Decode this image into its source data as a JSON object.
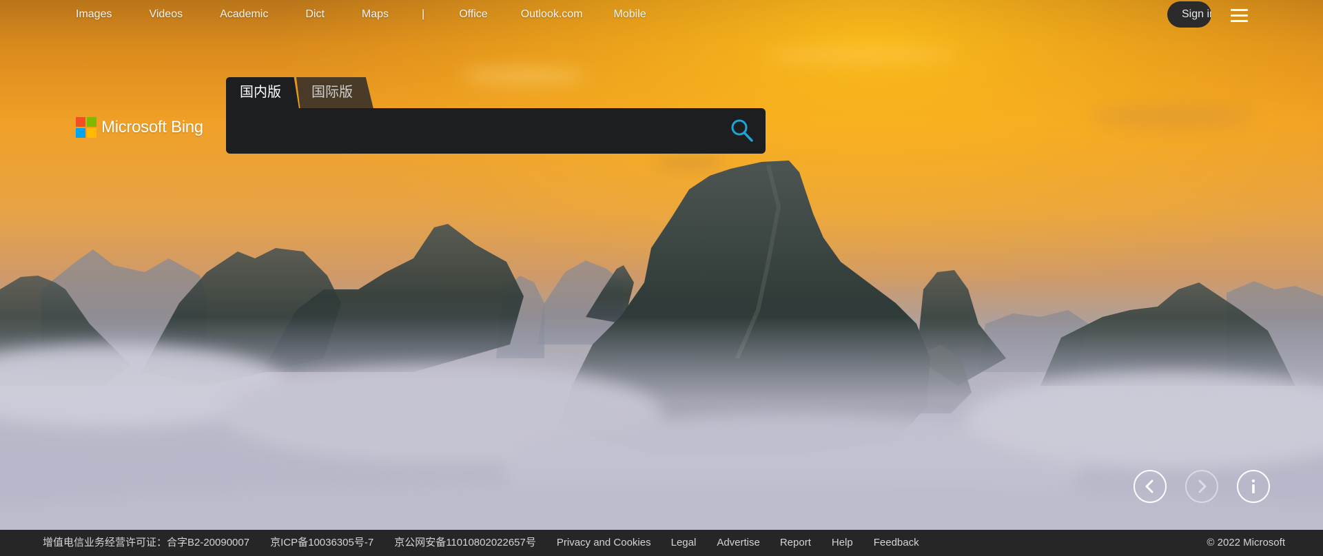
{
  "colors": {
    "sky_top": "#d98a1c",
    "sky_mid": "#f2a22a",
    "mist": "#b9b8c9",
    "mountain": "#2f3b3a",
    "search_bg": "#1d1e20",
    "search_icon": "#1aa7d6",
    "footer_bg": "#262626",
    "ms_red": "#f25022",
    "ms_green": "#7fba00",
    "ms_blue": "#00a4ef",
    "ms_yellow": "#ffb900"
  },
  "topnav": {
    "items": [
      "Images",
      "Videos",
      "Academic",
      "Dict",
      "Maps",
      "|",
      "Office",
      "Outlook.com",
      "Mobile"
    ],
    "signin_label": "Sign in",
    "menu_icon": "hamburger-icon"
  },
  "logo": {
    "text": "Microsoft Bing",
    "icon": "microsoft-logo"
  },
  "search": {
    "tabs": [
      "国内版",
      "国际版"
    ],
    "active_tab": "国内版",
    "value": "",
    "placeholder": "",
    "icon": "search-icon"
  },
  "carousel": {
    "prev_icon": "chevron-left-icon",
    "next_icon": "chevron-right-icon",
    "info_icon": "info-icon"
  },
  "footer": {
    "license": "增值电信业务经营许可证：合字B2-20090007",
    "icp": "京ICP备10036305号-7",
    "police": "京公网安备11010802022657号",
    "links": [
      "Privacy and Cookies",
      "Legal",
      "Advertise",
      "Report",
      "Help",
      "Feedback"
    ],
    "copyright": "© 2022 Microsoft"
  }
}
